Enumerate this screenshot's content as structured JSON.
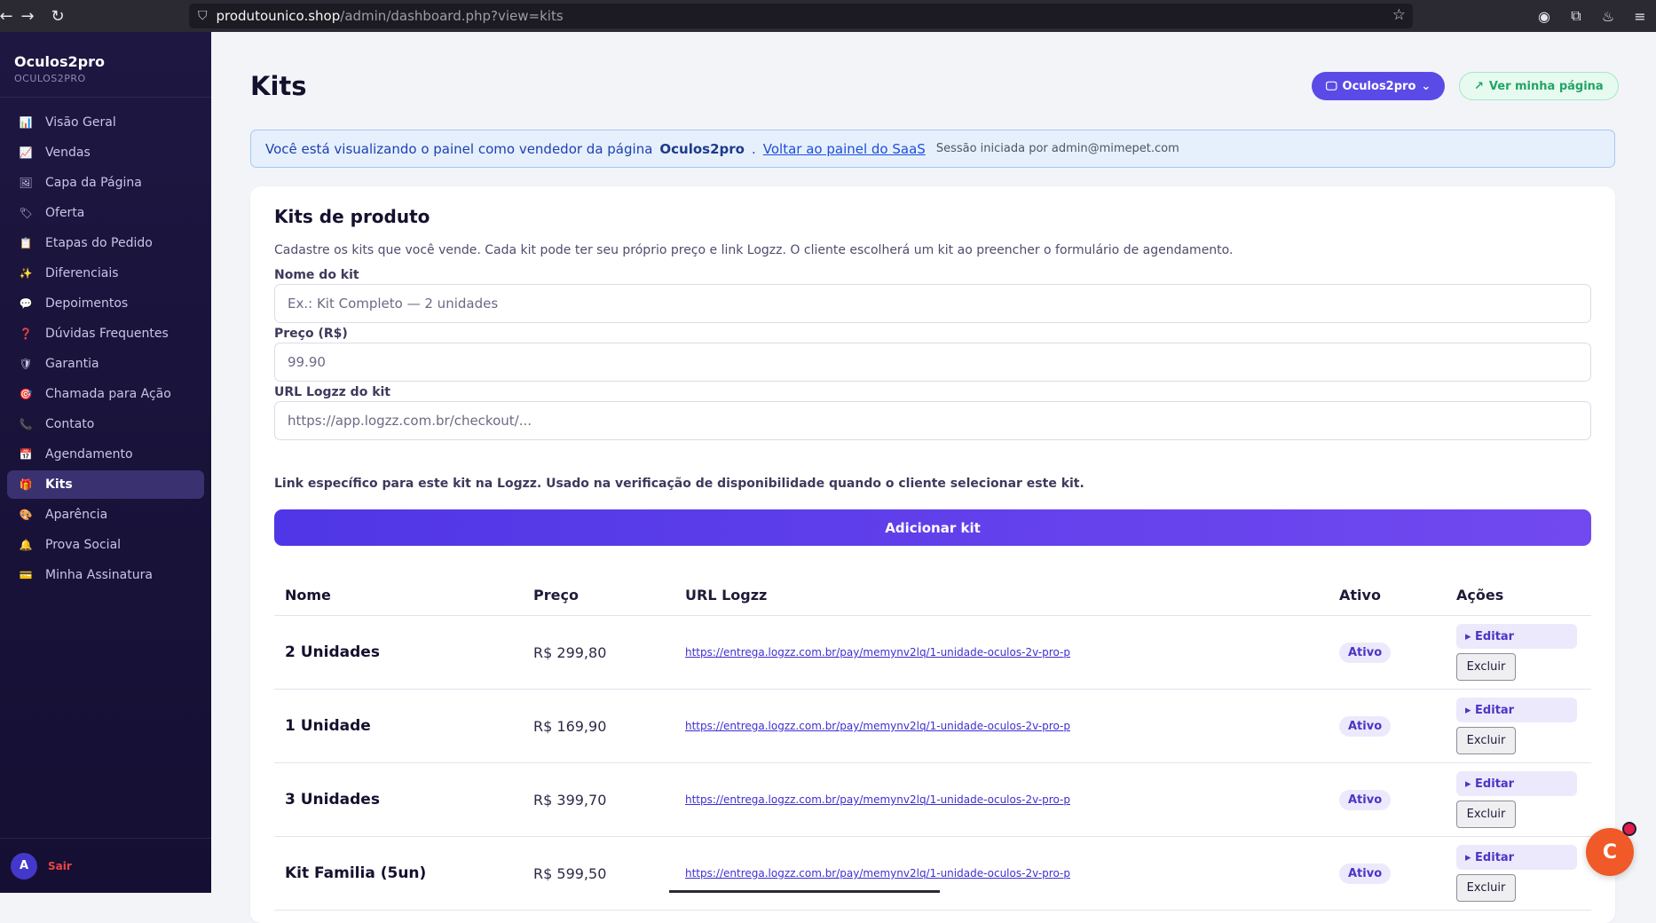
{
  "browser": {
    "url_host": "produtounico.shop",
    "url_path": "/admin/dashboard.php?view=kits"
  },
  "sidebar": {
    "brand_name": "Oculos2pro",
    "brand_sub": "OCULOS2PRO",
    "items": [
      {
        "label": "Visão Geral",
        "icon": "chart-icon"
      },
      {
        "label": "Vendas",
        "icon": "trend-icon"
      },
      {
        "label": "Capa da Página",
        "icon": "image-icon"
      },
      {
        "label": "Oferta",
        "icon": "tag-icon"
      },
      {
        "label": "Etapas do Pedido",
        "icon": "clipboard-icon"
      },
      {
        "label": "Diferenciais",
        "icon": "sparkles-icon"
      },
      {
        "label": "Depoimentos",
        "icon": "speech-bubble-icon"
      },
      {
        "label": "Dúvidas Frequentes",
        "icon": "question-icon"
      },
      {
        "label": "Garantia",
        "icon": "shield-icon"
      },
      {
        "label": "Chamada para Ação",
        "icon": "target-icon"
      },
      {
        "label": "Contato",
        "icon": "phone-icon"
      },
      {
        "label": "Agendamento",
        "icon": "calendar-icon"
      },
      {
        "label": "Kits",
        "icon": "gift-icon"
      },
      {
        "label": "Aparência",
        "icon": "palette-icon"
      },
      {
        "label": "Prova Social",
        "icon": "bell-icon"
      },
      {
        "label": "Minha Assinatura",
        "icon": "card-icon"
      }
    ],
    "active_index": 12,
    "avatar_letter": "A",
    "logout_label": "Sair"
  },
  "header": {
    "title": "Kits",
    "store_button": "Oculos2pro",
    "view_page_button": "Ver minha página"
  },
  "notice": {
    "prefix": "Você está visualizando o painel como vendedor da página",
    "store_name": "Oculos2pro",
    "dot": ".",
    "link": "Voltar ao painel do SaaS",
    "session": "Sessão iniciada por admin@mimepet.com"
  },
  "form": {
    "title": "Kits de produto",
    "description": "Cadastre os kits que você vende. Cada kit pode ter seu próprio preço e link Logzz. O cliente escolherá um kit ao preencher o formulário de agendamento.",
    "name_label": "Nome do kit",
    "name_placeholder": "Ex.: Kit Completo — 2 unidades",
    "price_label": "Preço (R$)",
    "price_value": "99.90",
    "url_label": "URL Logzz do kit",
    "url_placeholder": "https://app.logzz.com.br/checkout/...",
    "url_help": "Link específico para este kit na Logzz. Usado na verificação de disponibilidade quando o cliente selecionar este kit.",
    "add_button": "Adicionar kit"
  },
  "table": {
    "headers": {
      "name": "Nome",
      "price": "Preço",
      "url": "URL Logzz",
      "active": "Ativo",
      "actions": "Ações"
    },
    "rows": [
      {
        "name": "2 Unidades",
        "price": "R$ 299,80",
        "url": "https://entrega.logzz.com.br/pay/memynv2lq/1-unidade-oculos-2v-pro-p",
        "status": "Ativo",
        "edit": "▸ Editar",
        "delete": "Excluir"
      },
      {
        "name": "1 Unidade",
        "price": "R$ 169,90",
        "url": "https://entrega.logzz.com.br/pay/memynv2lq/1-unidade-oculos-2v-pro-p",
        "status": "Ativo",
        "edit": "▸ Editar",
        "delete": "Excluir"
      },
      {
        "name": "3 Unidades",
        "price": "R$ 399,70",
        "url": "https://entrega.logzz.com.br/pay/memynv2lq/1-unidade-oculos-2v-pro-p",
        "status": "Ativo",
        "edit": "▸ Editar",
        "delete": "Excluir"
      },
      {
        "name": "Kit Familia (5un)",
        "price": "R$ 599,50",
        "url": "https://entrega.logzz.com.br/pay/memynv2lq/1-unidade-oculos-2v-pro-p",
        "status": "Ativo",
        "edit": "▸ Editar",
        "delete": "Excluir"
      }
    ]
  },
  "chat_widget": {
    "letter": "C"
  }
}
